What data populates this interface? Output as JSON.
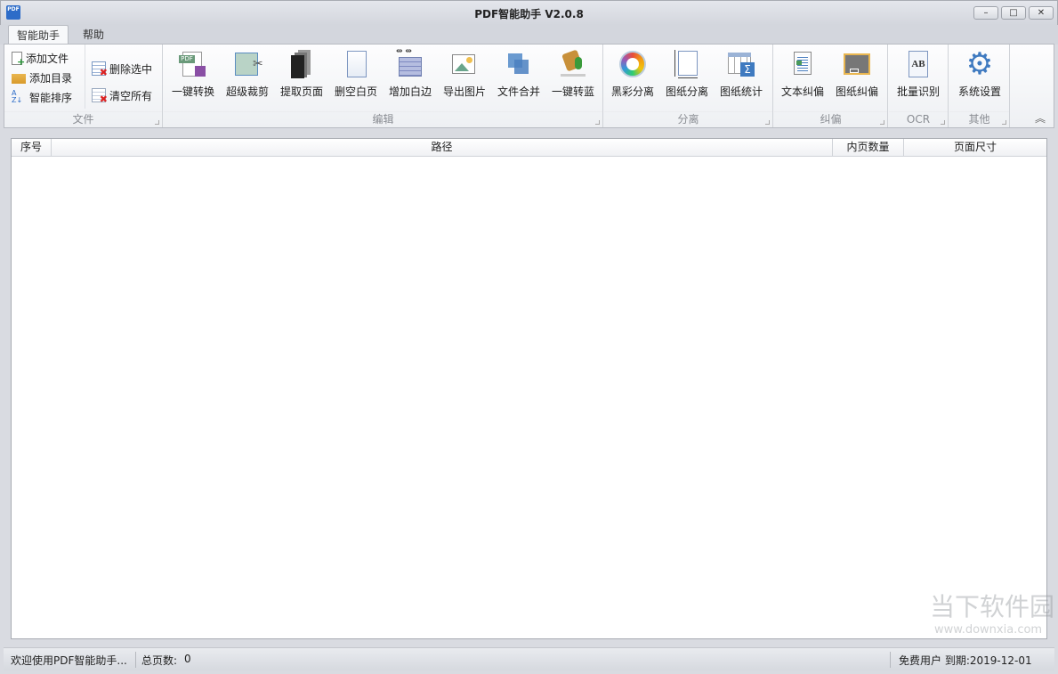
{
  "window": {
    "title": "PDF智能助手 V2.0.8",
    "icon_text": "PDF",
    "minimize": "–",
    "maximize": "□",
    "close": "✕"
  },
  "tabs": [
    {
      "label": "智能助手"
    },
    {
      "label": "帮助"
    }
  ],
  "ribbon": {
    "file": {
      "label": "文件",
      "add_file": "添加文件",
      "add_dir": "添加目录",
      "smart_sort": "智能排序",
      "delete_selected": "删除选中",
      "clear_all": "清空所有"
    },
    "edit": {
      "label": "编辑",
      "buttons": [
        "一键转换",
        "超级裁剪",
        "提取页面",
        "删空白页",
        "增加白边",
        "导出图片",
        "文件合并",
        "一键转蓝"
      ]
    },
    "separate": {
      "label": "分离",
      "buttons": [
        "黑彩分离",
        "图纸分离",
        "图纸统计"
      ]
    },
    "deskew": {
      "label": "纠偏",
      "buttons": [
        "文本纠偏",
        "图纸纠偏"
      ]
    },
    "ocr": {
      "label": "OCR",
      "buttons": [
        "批量识别"
      ]
    },
    "other": {
      "label": "其他",
      "buttons": [
        "系统设置"
      ]
    },
    "collapse": "︽"
  },
  "table": {
    "columns": [
      "序号",
      "路径",
      "内页数量",
      "页面尺寸"
    ],
    "rows": []
  },
  "status": {
    "welcome": "欢迎使用PDF智能助手...",
    "total_pages_label": "总页数:",
    "total_pages": "0",
    "user": "免费用户 到期:2019-12-01"
  },
  "watermark": {
    "name": "当下软件园",
    "url": "www.downxia.com"
  },
  "colors": {
    "accent": "#2d6cc8",
    "gear": "#3f7ac0"
  }
}
